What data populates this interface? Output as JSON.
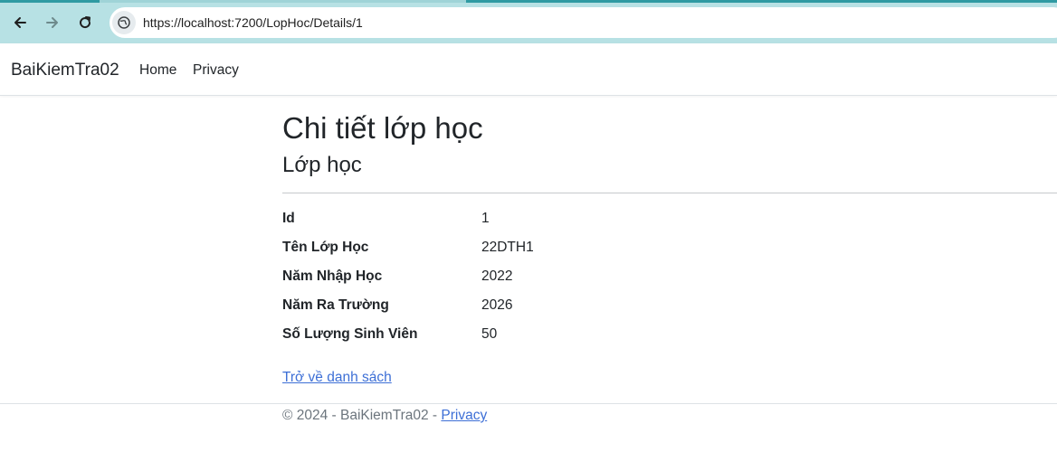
{
  "browser": {
    "url": "https://localhost:7200/LopHoc/Details/1"
  },
  "navbar": {
    "brand": "BaiKiemTra02",
    "links": [
      "Home",
      "Privacy"
    ]
  },
  "main": {
    "title": "Chi tiết lớp học",
    "subtitle": "Lớp học",
    "details": [
      {
        "label": "Id",
        "value": "1"
      },
      {
        "label": "Tên Lớp Học",
        "value": "22DTH1"
      },
      {
        "label": "Năm Nhập Học",
        "value": "2022"
      },
      {
        "label": "Năm Ra Trường",
        "value": "2026"
      },
      {
        "label": "Số Lượng Sinh Viên",
        "value": "50"
      }
    ],
    "back_link": "Trở về danh sách"
  },
  "footer": {
    "text": "© 2024 - BaiKiemTra02 - ",
    "privacy_link": "Privacy"
  },
  "colors": {
    "chrome": "#b7e1e4",
    "link": "#3d6fd6",
    "text": "#212529",
    "muted": "#6c757d"
  }
}
